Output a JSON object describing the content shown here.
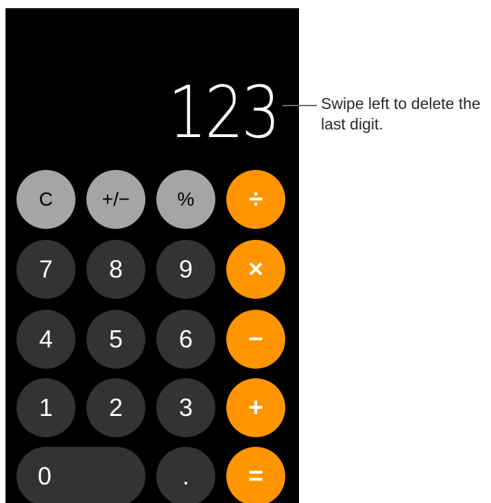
{
  "display": {
    "value": "123"
  },
  "callout": {
    "text": "Swipe left to delete the last digit."
  },
  "keys": {
    "clear": "C",
    "sign": "+/−",
    "percent": "%",
    "divide": "÷",
    "seven": "7",
    "eight": "8",
    "nine": "9",
    "multiply": "×",
    "four": "4",
    "five": "5",
    "six": "6",
    "subtract": "−",
    "one": "1",
    "two": "2",
    "three": "3",
    "add": "+",
    "zero": "0",
    "decimal": ".",
    "equals": "="
  },
  "colors": {
    "background": "#000000",
    "function_key": "#a5a5a5",
    "number_key": "#333333",
    "operator_key": "#ff9500"
  }
}
